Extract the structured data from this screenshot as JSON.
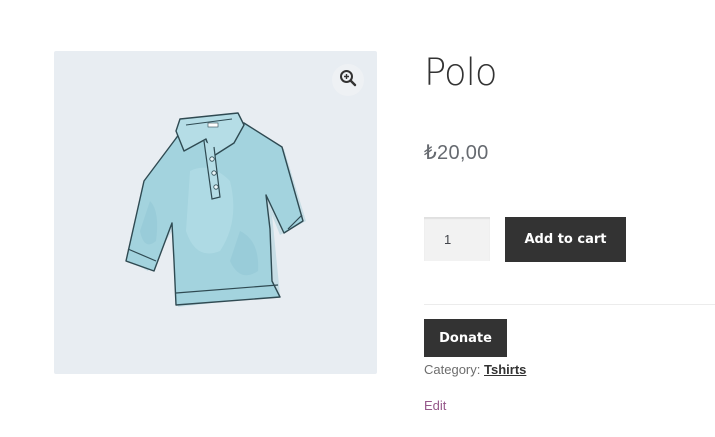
{
  "product": {
    "title": "Polo",
    "price": "₺20,00",
    "quantity": "1",
    "image_icon": "polo-shirt-illustration"
  },
  "actions": {
    "add_to_cart_label": "Add to cart",
    "donate_label": "Donate",
    "edit_label": "Edit",
    "zoom_icon": "magnifier-zoom-icon"
  },
  "meta": {
    "category_label": "Category:",
    "category_value": "Tshirts"
  },
  "colors": {
    "button_bg": "#333333",
    "gallery_bg": "#e8edf2",
    "shirt": "#9fd0dc",
    "edit_link": "#96588a"
  }
}
